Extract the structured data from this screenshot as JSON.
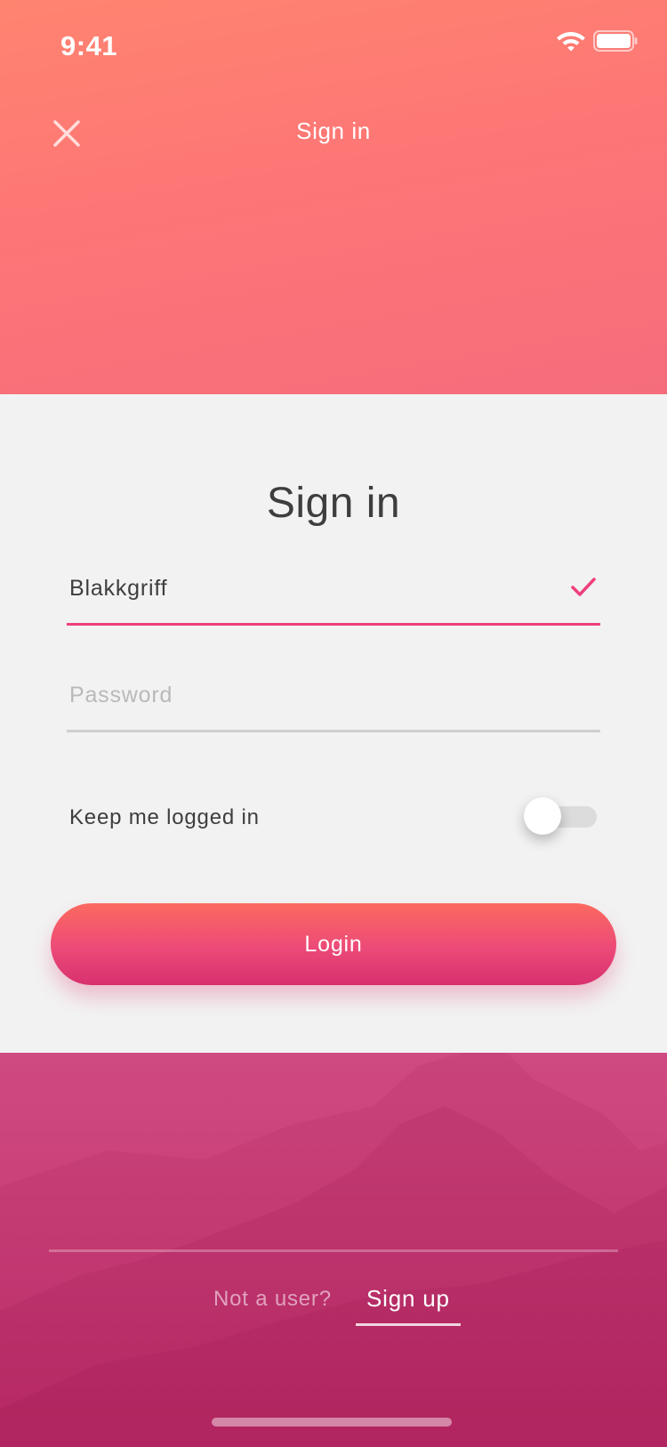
{
  "status_bar": {
    "time": "9:41",
    "icons": [
      "wifi-icon",
      "battery-icon"
    ]
  },
  "header": {
    "close_icon": "close-icon",
    "title": "Sign in"
  },
  "form": {
    "title": "Sign in",
    "username": {
      "value": "Blakkgriff",
      "valid_icon": "check-icon"
    },
    "password": {
      "value": "",
      "placeholder": "Password"
    },
    "keep_logged_in": {
      "label": "Keep me logged in",
      "enabled": false
    },
    "login_label": "Login"
  },
  "footer": {
    "prompt": "Not a user?",
    "signup_label": "Sign up"
  },
  "colors": {
    "accent": "#ef3f7e",
    "header_gradient_top": "#ff8470",
    "header_gradient_bottom": "#f56d7c",
    "button_gradient_top": "#fc6a5f",
    "button_gradient_bottom": "#d8306f",
    "footer_background": "#c73a74"
  }
}
